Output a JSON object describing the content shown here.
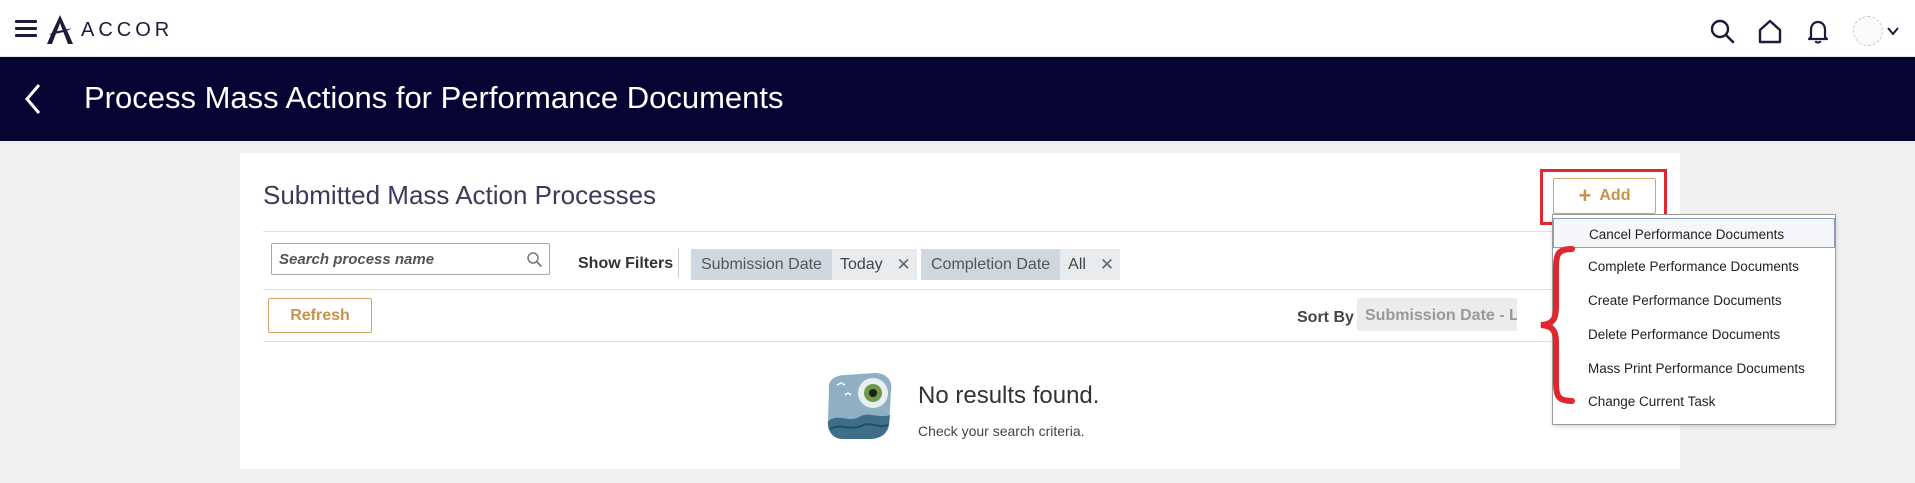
{
  "header": {
    "logo_text": "ACCOR",
    "icons": [
      "menu-icon",
      "search-icon",
      "home-icon",
      "bell-icon",
      "avatar",
      "chevron-down-icon"
    ]
  },
  "titlebar": {
    "title": "Process Mass Actions for Performance Documents",
    "background": "#060432"
  },
  "main": {
    "section_title": "Submitted Mass Action Processes",
    "search_placeholder": "Search process name",
    "show_filters_label": "Show Filters",
    "filters": [
      {
        "label": "Submission Date",
        "value": "Today"
      },
      {
        "label": "Completion Date",
        "value": "All"
      }
    ],
    "refresh_label": "Refresh",
    "sort_by_label": "Sort By",
    "sort_value": "Submission Date - Latest",
    "empty_title": "No results found.",
    "empty_subtitle": "Check your search criteria."
  },
  "add_button": {
    "label": "Add",
    "accent": "#c9924a"
  },
  "add_menu": {
    "items": [
      "Cancel Performance Documents",
      "Complete Performance Documents",
      "Create Performance Documents",
      "Delete Performance Documents",
      "Mass Print Performance Documents",
      "Change Current Task"
    ]
  },
  "annotation_color": "#e0262e"
}
